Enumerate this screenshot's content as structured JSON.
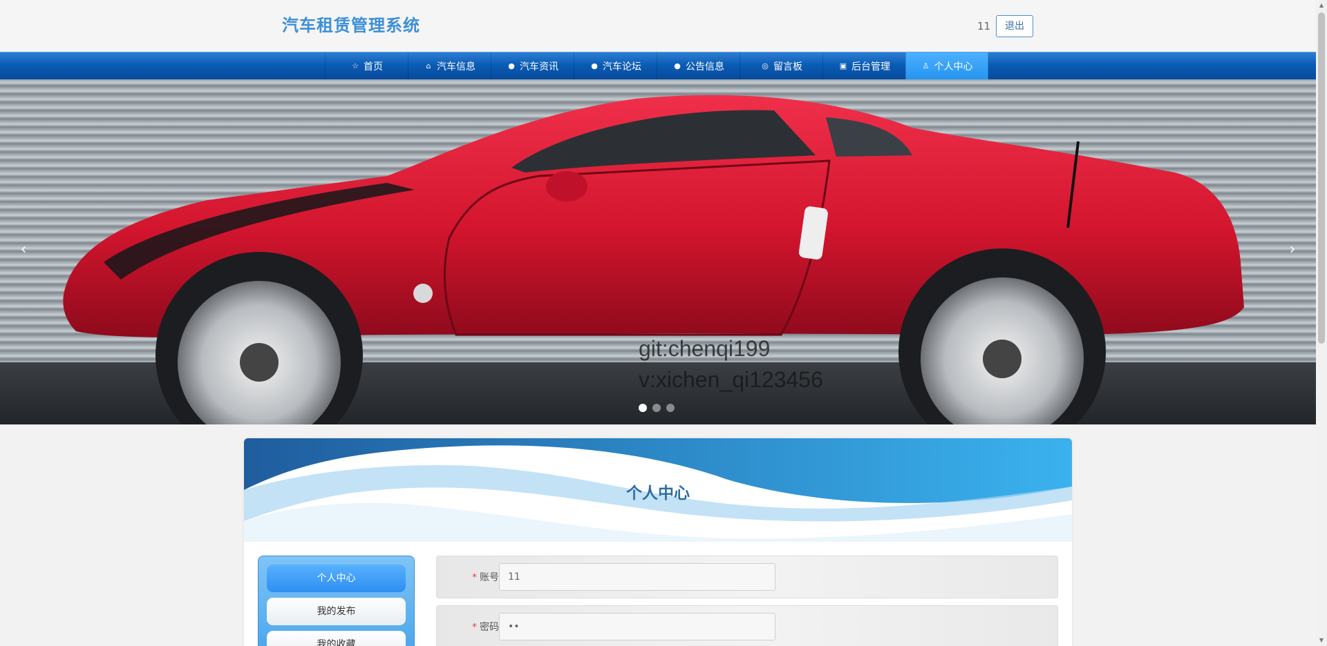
{
  "header": {
    "site_title": "汽车租赁管理系统",
    "username": "11",
    "logout_label": "退出"
  },
  "nav": {
    "items": [
      {
        "label": "首页",
        "icon": "star-icon",
        "glyph": "☆"
      },
      {
        "label": "汽车信息",
        "icon": "bag-icon",
        "glyph": "⌂"
      },
      {
        "label": "汽车资讯",
        "icon": "info-circle-icon",
        "glyph": "●"
      },
      {
        "label": "汽车论坛",
        "icon": "question-circle-icon",
        "glyph": "●"
      },
      {
        "label": "公告信息",
        "icon": "info-circle-icon",
        "glyph": "●"
      },
      {
        "label": "留言板",
        "icon": "chat-icon",
        "glyph": "◎"
      },
      {
        "label": "后台管理",
        "icon": "briefcase-icon",
        "glyph": "▣"
      },
      {
        "label": "个人中心",
        "icon": "user-icon",
        "glyph": "♙"
      }
    ],
    "active_index": 7,
    "active_color": "#2495f0",
    "bar_color": "#0b5cb5"
  },
  "banner": {
    "watermark_line1": "git:chenqi199",
    "watermark_line2": "v:xichen_qi123456",
    "prev_glyph": "‹",
    "next_glyph": "›",
    "slide_count": 3,
    "active_slide": 0
  },
  "panel": {
    "title": "个人中心",
    "side_menu": [
      "个人中心",
      "我的发布",
      "我的收藏"
    ],
    "side_active_index": 0,
    "fields": [
      {
        "label": "账号",
        "value": "11",
        "required": "*"
      },
      {
        "label": "密码",
        "value": "••",
        "required": "*"
      }
    ]
  }
}
